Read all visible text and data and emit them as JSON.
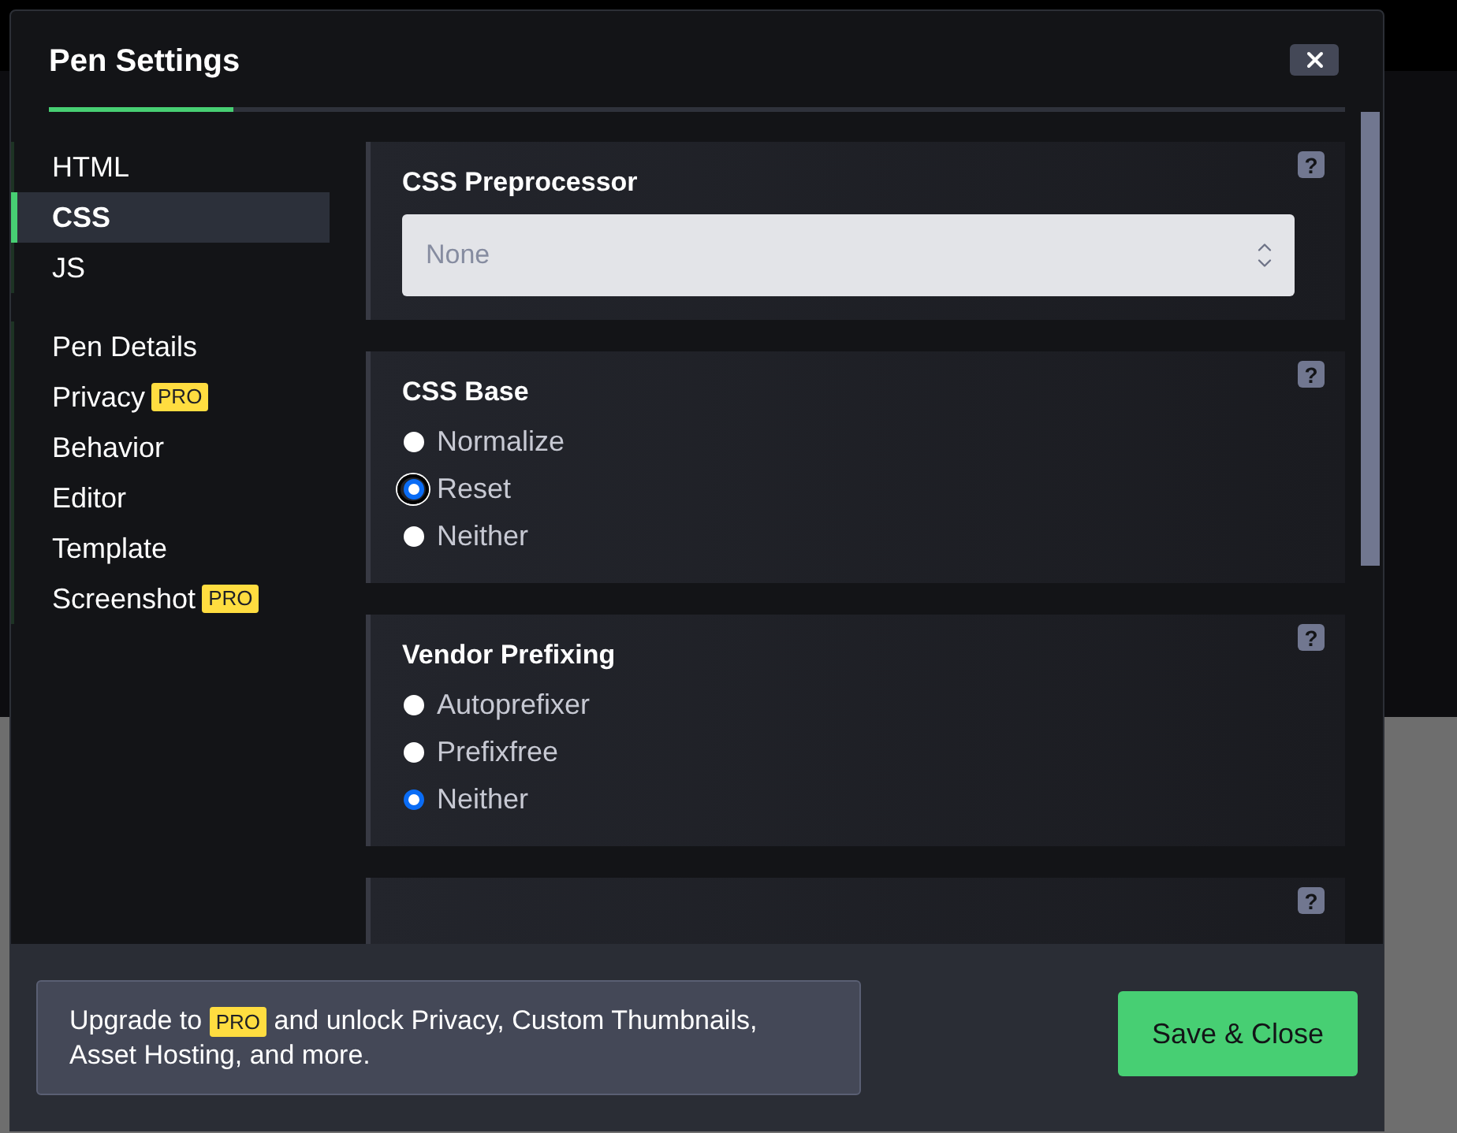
{
  "dialog": {
    "title": "Pen Settings"
  },
  "sidebar": {
    "groups": [
      {
        "items": [
          {
            "label": "HTML",
            "selected": false
          },
          {
            "label": "CSS",
            "selected": true
          },
          {
            "label": "JS",
            "selected": false
          }
        ]
      },
      {
        "items": [
          {
            "label": "Pen Details",
            "selected": false
          },
          {
            "label": "Privacy",
            "selected": false,
            "badge": "PRO"
          },
          {
            "label": "Behavior",
            "selected": false
          },
          {
            "label": "Editor",
            "selected": false
          },
          {
            "label": "Template",
            "selected": false
          },
          {
            "label": "Screenshot",
            "selected": false,
            "badge": "PRO"
          }
        ]
      }
    ]
  },
  "sections": [
    {
      "kind": "select",
      "title": "CSS Preprocessor",
      "value": "None",
      "help": "?"
    },
    {
      "kind": "radio",
      "title": "CSS Base",
      "help": "?",
      "options": [
        {
          "label": "Normalize",
          "selected": false,
          "focused": false
        },
        {
          "label": "Reset",
          "selected": true,
          "focused": true
        },
        {
          "label": "Neither",
          "selected": false,
          "focused": false
        }
      ]
    },
    {
      "kind": "radio",
      "title": "Vendor Prefixing",
      "help": "?",
      "options": [
        {
          "label": "Autoprefixer",
          "selected": false,
          "focused": false
        },
        {
          "label": "Prefixfree",
          "selected": false,
          "focused": false
        },
        {
          "label": "Neither",
          "selected": true,
          "focused": false
        }
      ]
    },
    {
      "kind": "hidden",
      "help": "?"
    }
  ],
  "footer": {
    "upgrade": {
      "before": "Upgrade to",
      "badge": "PRO",
      "after": [
        "and unlock Privacy, Custom Thumbnails,",
        "Asset Hosting, and more."
      ]
    },
    "save_button": "Save & Close"
  }
}
